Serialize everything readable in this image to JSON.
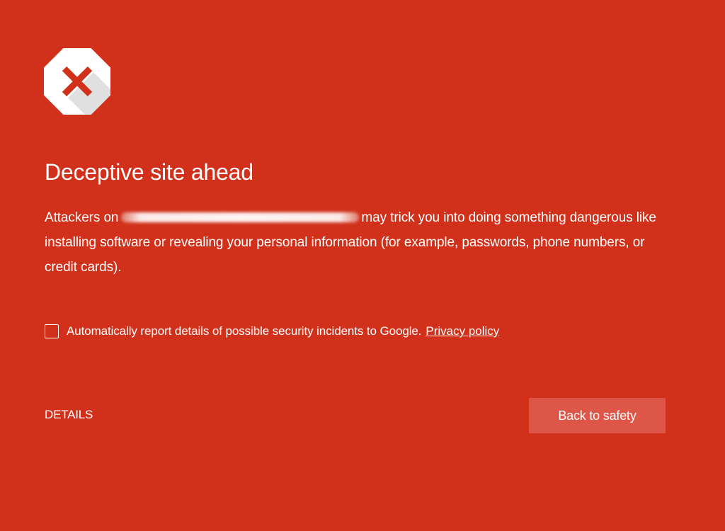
{
  "colors": {
    "background": "#d1311b",
    "button": "#de5647",
    "text": "#ffffff",
    "icon_x": "#d1311b"
  },
  "icon": {
    "name": "stop-sign-x-icon"
  },
  "title": "Deceptive site ahead",
  "message": {
    "prefix": "Attackers on",
    "redacted_domain": "",
    "suffix": "may trick you into doing something dangerous like installing software or revealing your personal information (for example, passwords, phone numbers, or credit cards)."
  },
  "report": {
    "checked": false,
    "label": "Automatically report details of possible security incidents to Google.",
    "privacy_link": "Privacy policy"
  },
  "details_label": "DETAILS",
  "back_button_label": "Back to safety"
}
